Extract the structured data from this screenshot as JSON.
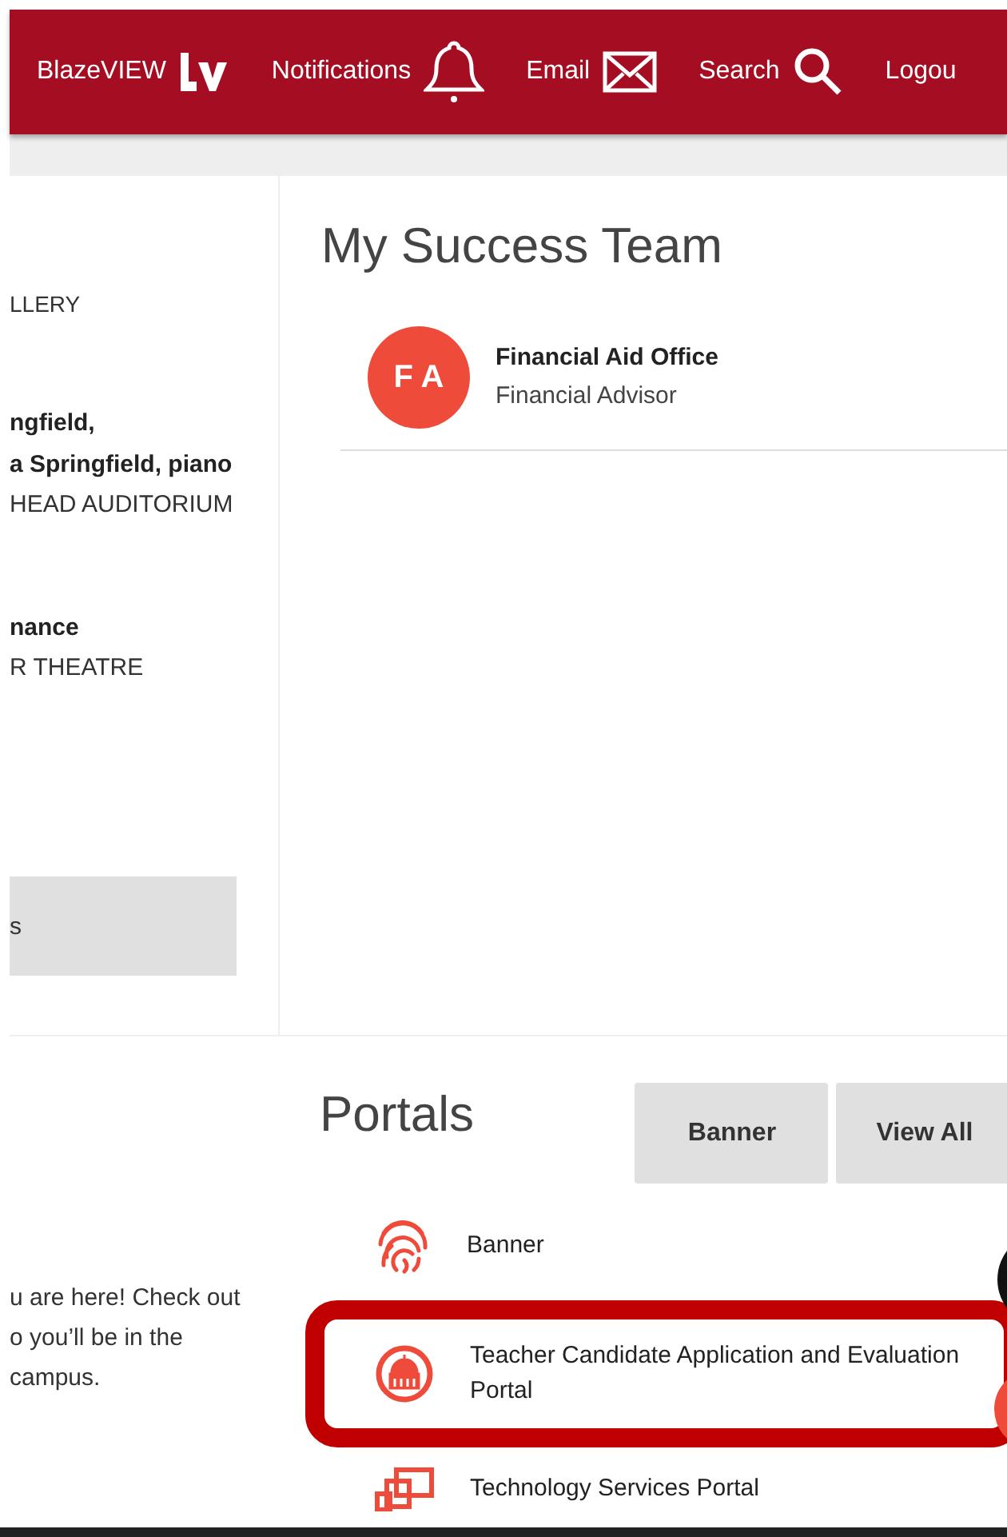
{
  "header": {
    "links": [
      {
        "label": "BlazeVIEW",
        "kind": "logo"
      },
      {
        "label": "Notifications",
        "kind": "bell"
      },
      {
        "label": "Email",
        "kind": "mail"
      },
      {
        "label": "Search",
        "kind": "search"
      },
      {
        "label": "Logou",
        "kind": "none"
      }
    ]
  },
  "left_column": {
    "category": "LLERY",
    "events": [
      {
        "title_lines": [
          "ngfield,",
          "a Springfield, piano"
        ],
        "venue": "HEAD AUDITORIUM"
      },
      {
        "title_lines": [
          "nance"
        ],
        "venue": "R THEATRE"
      }
    ],
    "button": "s",
    "intro_lines": [
      "u are here! Check out",
      "o you’ll be in the",
      "campus."
    ]
  },
  "success_team": {
    "title": "My Success Team",
    "members": [
      {
        "initials": "F A",
        "name": "Financial Aid Office",
        "role": "Financial Advisor"
      }
    ]
  },
  "portals": {
    "title": "Portals",
    "buttons": [
      "Banner",
      "View All"
    ],
    "items": [
      {
        "label": "Banner",
        "kind": "fingerprint",
        "highlighted": false
      },
      {
        "label": "Teacher Candidate Application and Evaluation Portal",
        "kind": "building",
        "highlighted": true
      },
      {
        "label": "Technology Services Portal",
        "kind": "devices",
        "highlighted": false
      }
    ]
  }
}
